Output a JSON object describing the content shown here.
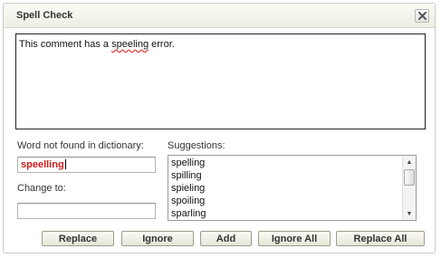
{
  "dialog": {
    "title": "Spell Check",
    "close_icon": "close-icon"
  },
  "comment": {
    "before": "This comment has a ",
    "misspelled": "speeling",
    "after": " error."
  },
  "word_not_found": {
    "label": "Word not found in dictionary:",
    "value": "speelling"
  },
  "change_to": {
    "label": "Change to:",
    "value": ""
  },
  "suggestions": {
    "label": "Suggestions:",
    "items": [
      "spelling",
      "spilling",
      "spieling",
      "spoiling",
      "sparling"
    ]
  },
  "buttons": {
    "replace": "Replace",
    "ignore": "Ignore",
    "add": "Add",
    "ignore_all": "Ignore All",
    "replace_all": "Replace All"
  }
}
